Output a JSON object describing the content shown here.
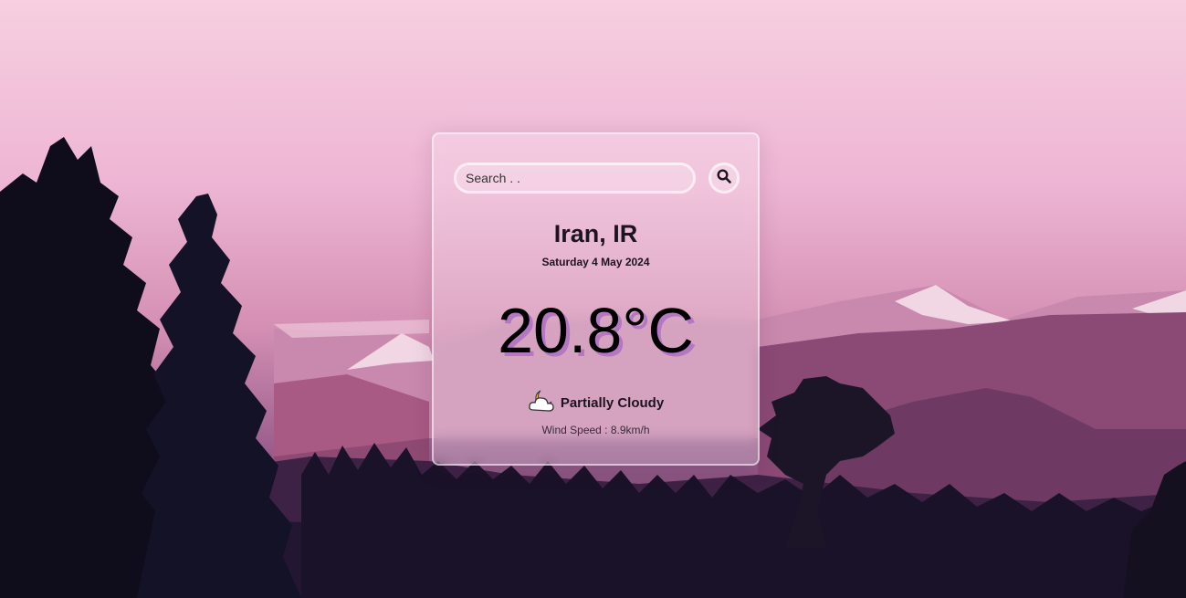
{
  "search": {
    "placeholder": "Search . .",
    "button_icon": "search-icon"
  },
  "weather": {
    "location": "Iran, IR",
    "date": "Saturday 4 May 2024",
    "temperature": "20.8°C",
    "condition": "Partially Cloudy",
    "condition_icon": "partly-cloudy-night-icon",
    "wind": "Wind Speed : 8.9km/h"
  },
  "colors": {
    "sky_top": "#f6cfe0",
    "sky_mid": "#d48fb3",
    "forest_dark": "#0f0d1c",
    "temp_shadow": "#b576c4"
  }
}
